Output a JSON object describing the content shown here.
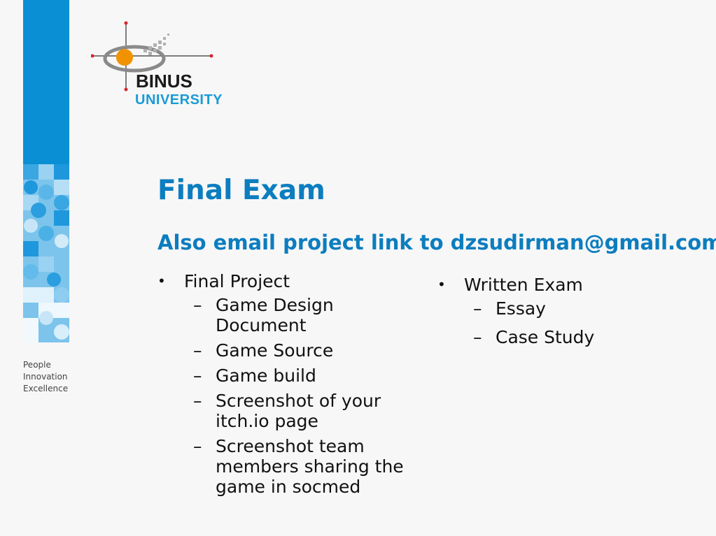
{
  "brand": {
    "logo_word1": "BINUS",
    "logo_word2": "UNIVERSITY",
    "tagline": [
      "People",
      "Innovation",
      "Excellence"
    ],
    "colors": {
      "primary_blue": "#0a8fd4",
      "title_blue": "#0c7dbf",
      "accent_orange": "#f39200"
    }
  },
  "slide": {
    "title": "Final Exam",
    "subtitle": "Also email project link to dzsudirman@gmail.com",
    "bullet_glyph": "•",
    "sub_glyph": "–",
    "left": {
      "heading": "Final Project",
      "items": [
        "Game Design Document",
        "Game Source",
        "Game build",
        "Screenshot of your itch.io page",
        "Screenshot team members sharing the game in socmed"
      ]
    },
    "right": {
      "heading": "Written Exam",
      "items": [
        "Essay",
        "Case Study"
      ]
    }
  }
}
